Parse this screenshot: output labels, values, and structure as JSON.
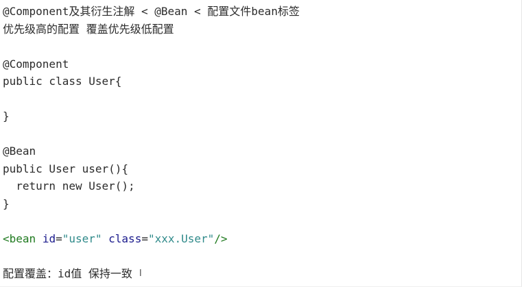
{
  "editor": {
    "lines": {
      "l1": "@Component及其衍生注解 < @Bean < 配置文件bean标签",
      "l2": "优先级高的配置 覆盖优先级低配置",
      "l3": "",
      "l4": "@Component",
      "l5": "public class User{",
      "l6": "",
      "l7": "}",
      "l8": "",
      "l9": "@Bean",
      "l10": "public User user(){",
      "l11": "  return new User();",
      "l12": "}",
      "l13": "",
      "l15": "",
      "l16": "配置覆盖：id值 保持一致"
    },
    "xml_line": {
      "tag_open": "<bean",
      "space1": " ",
      "attr_id": "id",
      "eq1": "=",
      "val_id": "\"user\"",
      "space2": " ",
      "attr_class": "class",
      "eq2": "=",
      "val_class": "\"xxx.User\"",
      "tag_close": "/>"
    },
    "cursor_glyph": "I"
  }
}
